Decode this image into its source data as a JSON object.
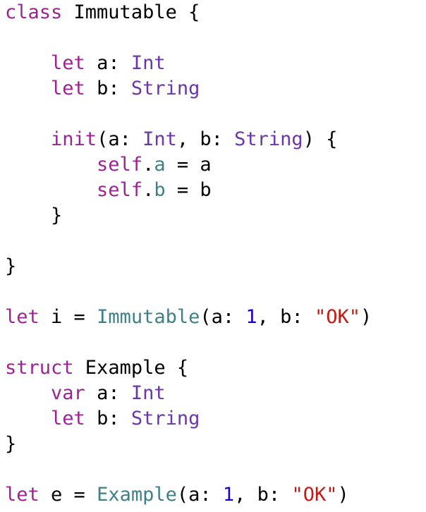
{
  "editor": {
    "lines": [
      [
        {
          "text": "class",
          "kind": "kw"
        },
        {
          "text": " Immutable {",
          "kind": "plain"
        }
      ],
      [],
      [
        {
          "text": "    ",
          "kind": "plain"
        },
        {
          "text": "let",
          "kind": "kw"
        },
        {
          "text": " a: ",
          "kind": "plain"
        },
        {
          "text": "Int",
          "kind": "typ"
        }
      ],
      [
        {
          "text": "    ",
          "kind": "plain"
        },
        {
          "text": "let",
          "kind": "kw"
        },
        {
          "text": " b: ",
          "kind": "plain"
        },
        {
          "text": "String",
          "kind": "typ"
        }
      ],
      [],
      [
        {
          "text": "    ",
          "kind": "plain"
        },
        {
          "text": "init",
          "kind": "kw"
        },
        {
          "text": "(a: ",
          "kind": "plain"
        },
        {
          "text": "Int",
          "kind": "typ"
        },
        {
          "text": ", b: ",
          "kind": "plain"
        },
        {
          "text": "String",
          "kind": "typ"
        },
        {
          "text": ") {",
          "kind": "plain"
        }
      ],
      [
        {
          "text": "        ",
          "kind": "plain"
        },
        {
          "text": "self",
          "kind": "kw"
        },
        {
          "text": ".",
          "kind": "plain"
        },
        {
          "text": "a",
          "kind": "prop"
        },
        {
          "text": " = a",
          "kind": "plain"
        }
      ],
      [
        {
          "text": "        ",
          "kind": "plain"
        },
        {
          "text": "self",
          "kind": "kw"
        },
        {
          "text": ".",
          "kind": "plain"
        },
        {
          "text": "b",
          "kind": "prop"
        },
        {
          "text": " = b",
          "kind": "plain"
        }
      ],
      [
        {
          "text": "    }",
          "kind": "plain"
        }
      ],
      [],
      [
        {
          "text": "}",
          "kind": "plain"
        }
      ],
      [],
      [
        {
          "text": "let",
          "kind": "kw"
        },
        {
          "text": " i = ",
          "kind": "plain"
        },
        {
          "text": "Immutable",
          "kind": "fn"
        },
        {
          "text": "(a: ",
          "kind": "plain"
        },
        {
          "text": "1",
          "kind": "num"
        },
        {
          "text": ", b: ",
          "kind": "plain"
        },
        {
          "text": "\"OK\"",
          "kind": "str"
        },
        {
          "text": ")",
          "kind": "plain"
        }
      ],
      [],
      [
        {
          "text": "struct",
          "kind": "kw"
        },
        {
          "text": " Example {",
          "kind": "plain"
        }
      ],
      [
        {
          "text": "    ",
          "kind": "plain"
        },
        {
          "text": "var",
          "kind": "kw"
        },
        {
          "text": " a: ",
          "kind": "plain"
        },
        {
          "text": "Int",
          "kind": "typ"
        }
      ],
      [
        {
          "text": "    ",
          "kind": "plain"
        },
        {
          "text": "let",
          "kind": "kw"
        },
        {
          "text": " b: ",
          "kind": "plain"
        },
        {
          "text": "String",
          "kind": "typ"
        }
      ],
      [
        {
          "text": "}",
          "kind": "plain"
        }
      ],
      [],
      [
        {
          "text": "let",
          "kind": "kw"
        },
        {
          "text": " e = ",
          "kind": "plain"
        },
        {
          "text": "Example",
          "kind": "fn"
        },
        {
          "text": "(a: ",
          "kind": "plain"
        },
        {
          "text": "1",
          "kind": "num"
        },
        {
          "text": ", b: ",
          "kind": "plain"
        },
        {
          "text": "\"OK\"",
          "kind": "str"
        },
        {
          "text": ")",
          "kind": "plain"
        }
      ]
    ]
  },
  "colors": {
    "background": "#ffffff",
    "keyword": "#9b2393",
    "type": "#6c36a9",
    "property": "#3e8087",
    "function": "#3e8087",
    "number": "#1c00cf",
    "string": "#c41a16",
    "plain": "#000000"
  }
}
